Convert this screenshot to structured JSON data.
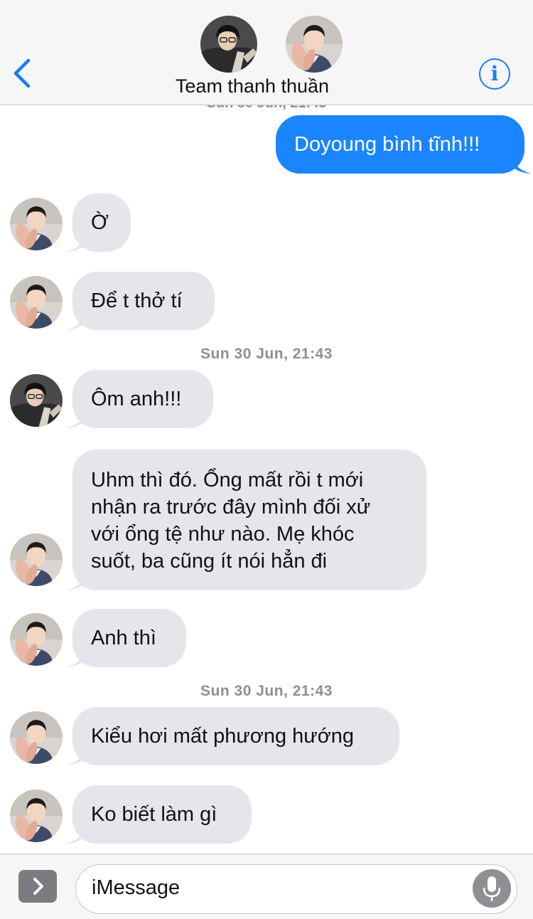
{
  "header": {
    "title": "Team thanh thuần",
    "back_icon": "chevron-left-icon",
    "info_icon": "info-icon",
    "info_glyph": "i",
    "accent": "#1a7cf5"
  },
  "conversation": {
    "timestamps": [
      "Sun 30 Jun, 21:43",
      "Sun 30 Jun, 21:43"
    ],
    "outgoing": [
      "Doyoung bình tĩnh!!!"
    ],
    "incoming": [
      "Ờ",
      "Để t thở tí",
      "Ôm anh!!!",
      "Uhm thì đó. Ổng mất rồi t mới nhận ra trước đây mình đối xử với ổng tệ như nào. Mẹ khóc suốt, ba cũng ít nói hẳn đi",
      "Anh thì",
      "Kiểu hơi mất phương hướng",
      "Ko biết làm gì"
    ],
    "long_lines": [
      "Uhm thì đó. Ổng mất rồi t mới",
      "nhận ra trước đây mình đối xử",
      "với ổng tệ như nào. Mẹ khóc",
      "suốt, ba cũng ít nói hẳn đi"
    ],
    "colors": {
      "incoming_bubble": "#e6e5eb",
      "outgoing_bubble": "#1a85ff",
      "timestamp": "#8e8e93"
    }
  },
  "input": {
    "placeholder": "iMessage",
    "apps_icon": "chevron-right-icon",
    "mic_icon": "microphone-icon"
  }
}
